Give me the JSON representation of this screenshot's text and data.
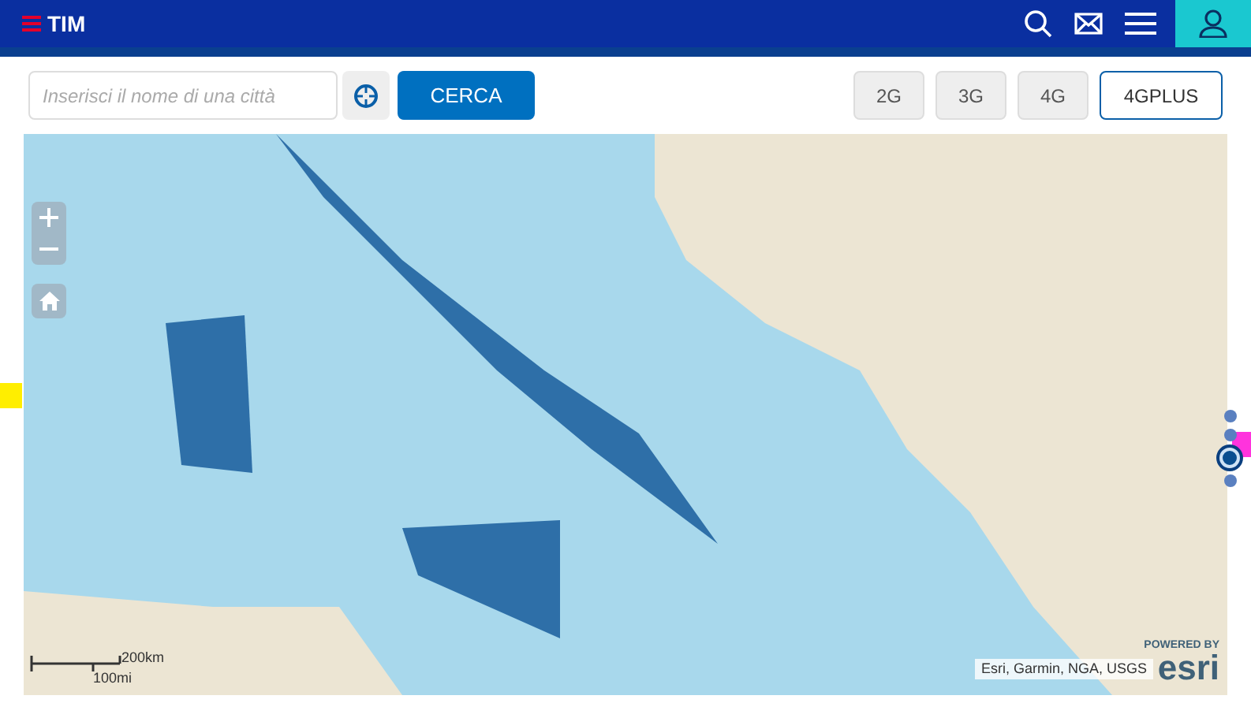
{
  "header": {
    "brand": "TIM"
  },
  "search": {
    "placeholder": "Inserisci il nome di una città",
    "button": "CERCA"
  },
  "networks": [
    {
      "label": "2G",
      "selected": false
    },
    {
      "label": "3G",
      "selected": false
    },
    {
      "label": "4G",
      "selected": false
    },
    {
      "label": "4GPLUS",
      "selected": true
    }
  ],
  "map": {
    "scale": {
      "metric": "200km",
      "imperial": "100mi"
    },
    "attribution": "Esri, Garmin, NGA, USGS",
    "logo": {
      "caption": "POWERED BY",
      "name": "esri"
    }
  },
  "pager": [
    {
      "selected": false
    },
    {
      "selected": false
    },
    {
      "selected": true
    },
    {
      "selected": false
    }
  ]
}
